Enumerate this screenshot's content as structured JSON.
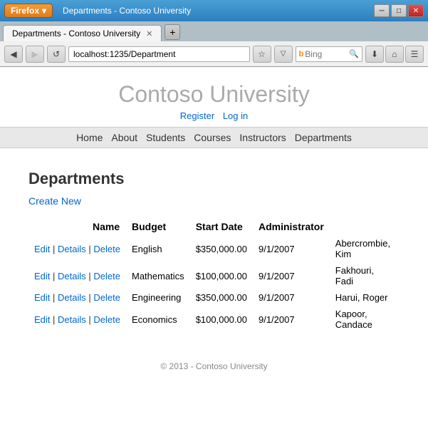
{
  "window": {
    "firefox_label": "Firefox",
    "title": "Departments - Contoso University",
    "close_btn": "✕",
    "min_btn": "─",
    "max_btn": "□",
    "new_tab_btn": "+"
  },
  "address_bar": {
    "url": "localhost:1235/Department",
    "search_placeholder": "Bing"
  },
  "site": {
    "title": "Contoso University",
    "auth_links": [
      {
        "label": "Register",
        "href": "#"
      },
      {
        "label": "Log in",
        "href": "#"
      }
    ],
    "nav_links": [
      {
        "label": "Home",
        "href": "#"
      },
      {
        "label": "About",
        "href": "#"
      },
      {
        "label": "Students",
        "href": "#"
      },
      {
        "label": "Courses",
        "href": "#"
      },
      {
        "label": "Instructors",
        "href": "#"
      },
      {
        "label": "Departments",
        "href": "#"
      }
    ]
  },
  "departments_page": {
    "title": "Departments",
    "create_new_label": "Create New",
    "columns": [
      "Name",
      "Budget",
      "Start Date",
      "Administrator"
    ],
    "rows": [
      {
        "name": "English",
        "budget": "$350,000.00",
        "start_date": "9/1/2007",
        "administrator": "Abercrombie, Kim"
      },
      {
        "name": "Mathematics",
        "budget": "$100,000.00",
        "start_date": "9/1/2007",
        "administrator": "Fakhouri, Fadi"
      },
      {
        "name": "Engineering",
        "budget": "$350,000.00",
        "start_date": "9/1/2007",
        "administrator": "Harui, Roger"
      },
      {
        "name": "Economics",
        "budget": "$100,000.00",
        "start_date": "9/1/2007",
        "administrator": "Kapoor, Candace"
      }
    ],
    "row_actions": [
      {
        "label": "Edit"
      },
      {
        "label": "Details"
      },
      {
        "label": "Delete"
      }
    ]
  },
  "footer": {
    "text": "© 2013 - Contoso University"
  }
}
